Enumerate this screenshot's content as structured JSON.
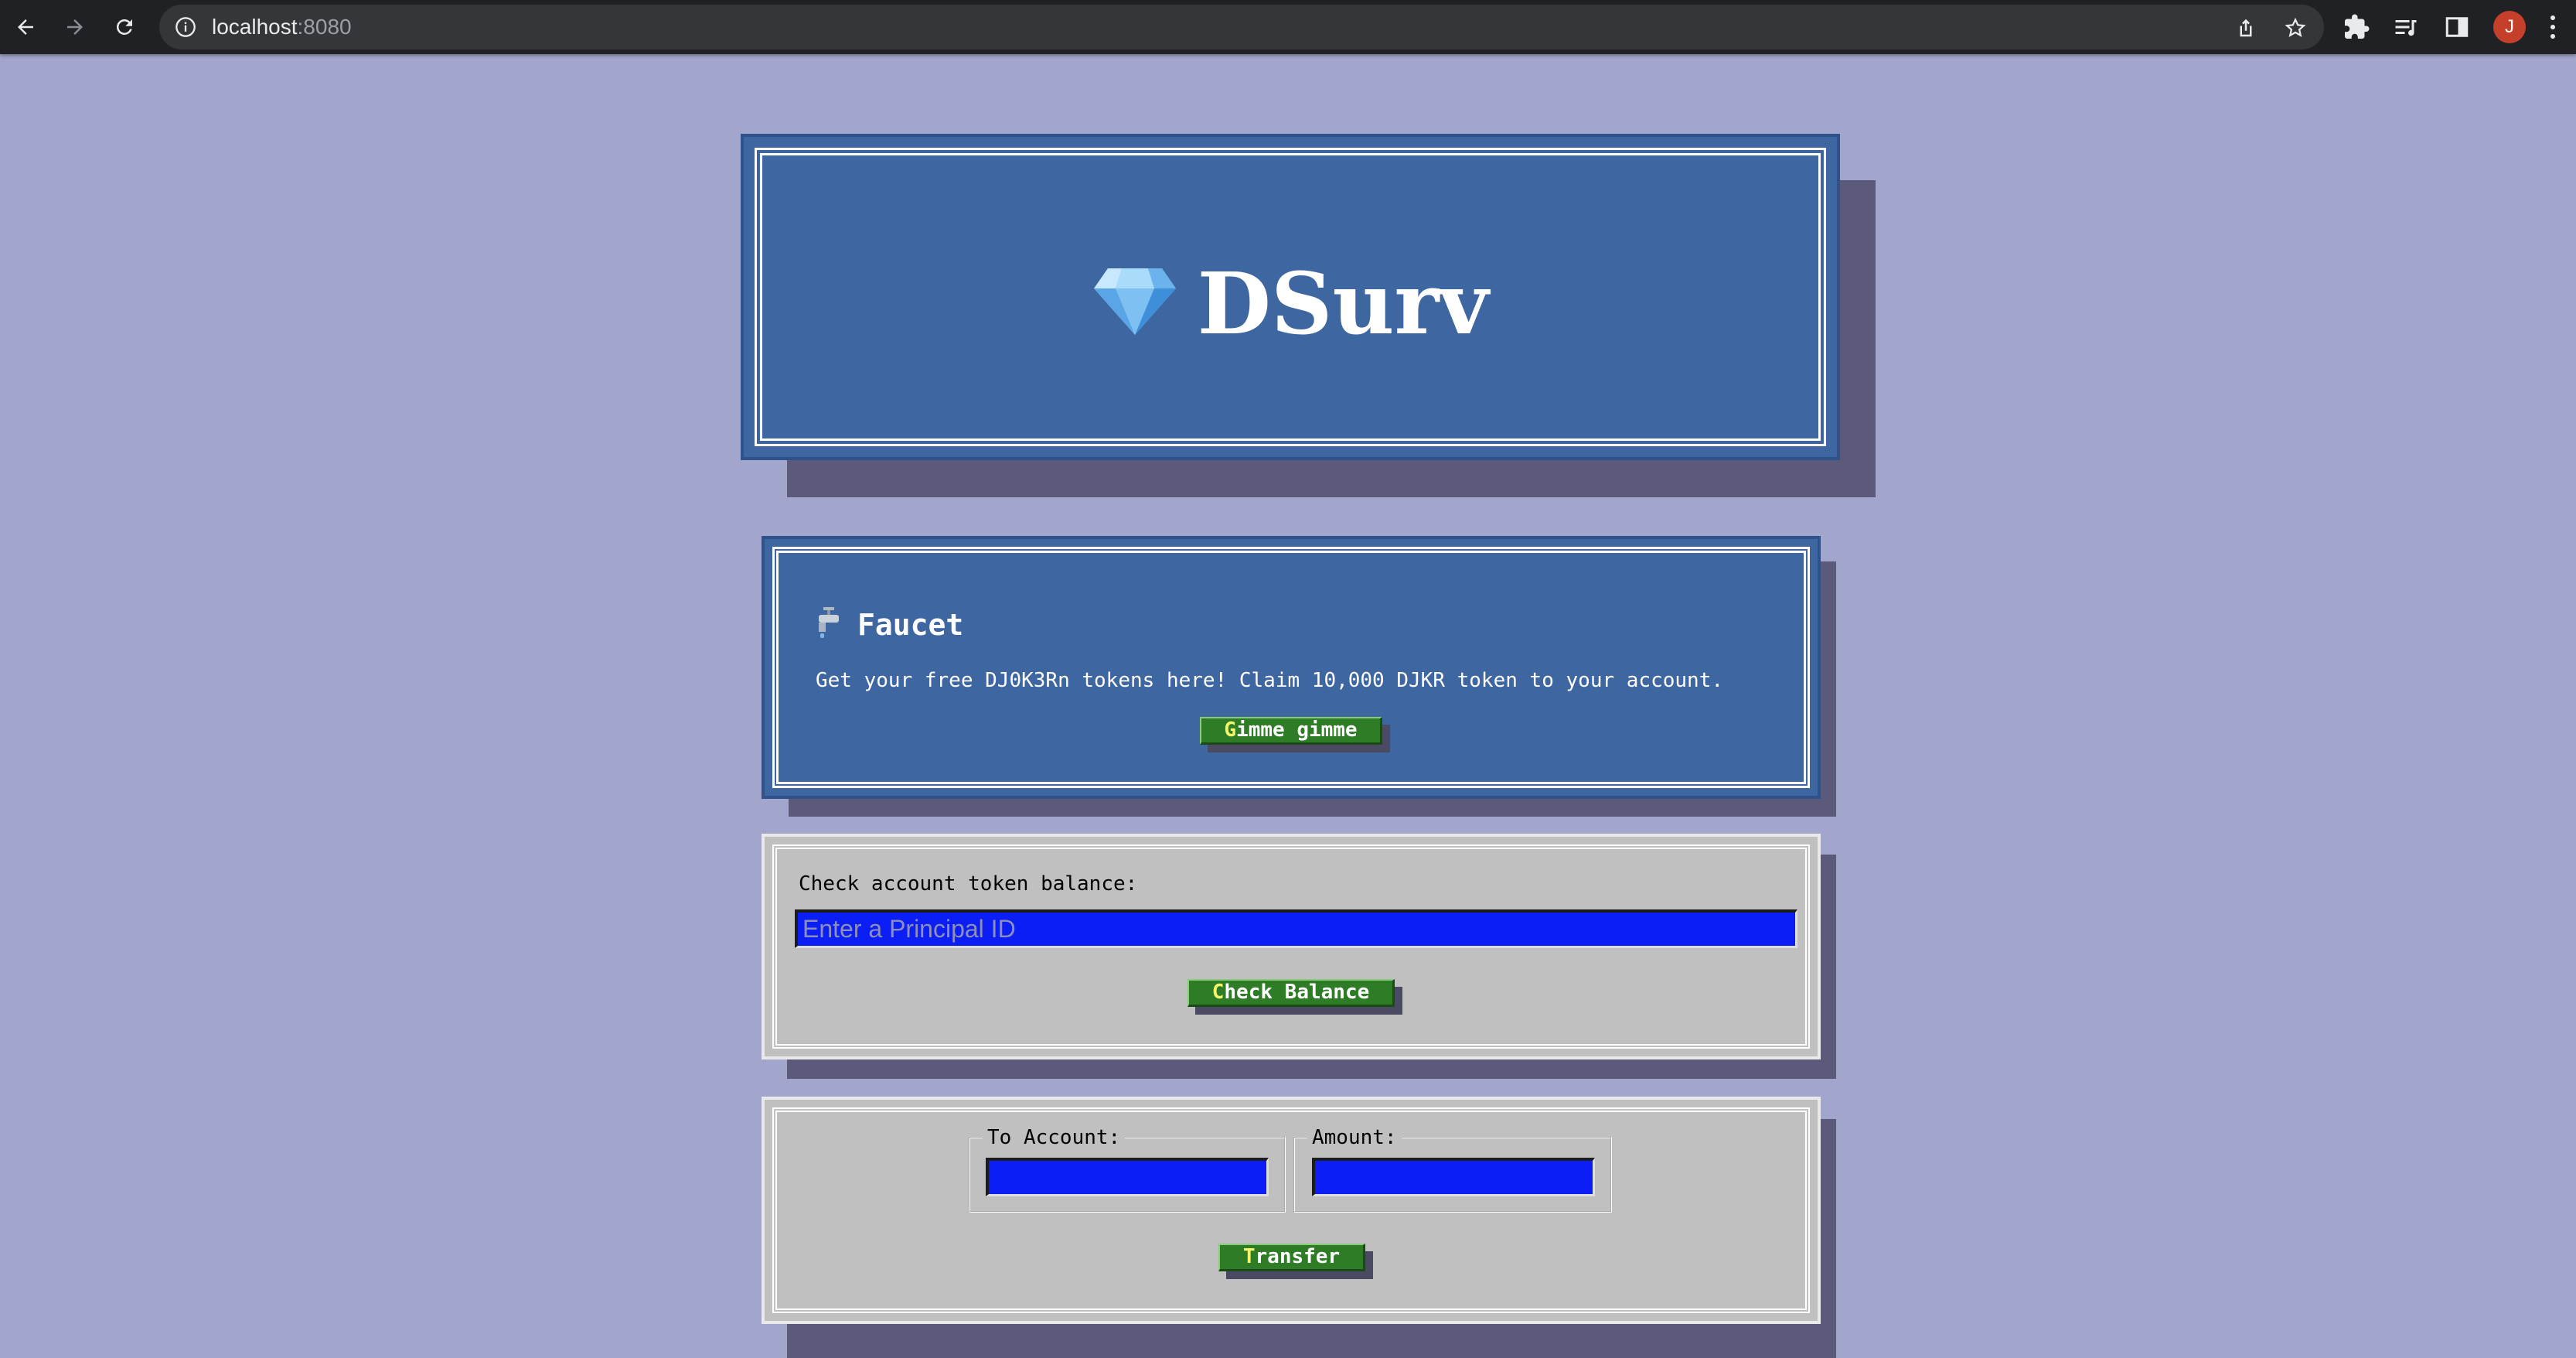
{
  "browser": {
    "url_host": "localhost",
    "url_port": ":8080",
    "profile_initial": "J"
  },
  "header": {
    "title": "DSurv",
    "logo_icon": "gem-icon"
  },
  "faucet": {
    "icon": "faucet-icon",
    "heading": "Faucet",
    "description": "Get your free DJ0K3Rn tokens here! Claim 10,000 DJKR token to your account.",
    "button_first_char": "G",
    "button_rest": "imme gimme"
  },
  "balance": {
    "label": "Check account token balance:",
    "input_placeholder": "Enter a Principal ID",
    "button_first_char": "C",
    "button_rest": "heck Balance"
  },
  "transfer": {
    "to_label": "To Account:",
    "amount_label": "Amount:",
    "button_first_char": "T",
    "button_rest": "ransfer"
  },
  "colors": {
    "page_bg": "#a3a6cc",
    "panel_blue": "#3e66a1",
    "panel_grey": "#c0c0c0",
    "button_green": "#2e7d26",
    "input_blue": "#0a1ef5"
  }
}
